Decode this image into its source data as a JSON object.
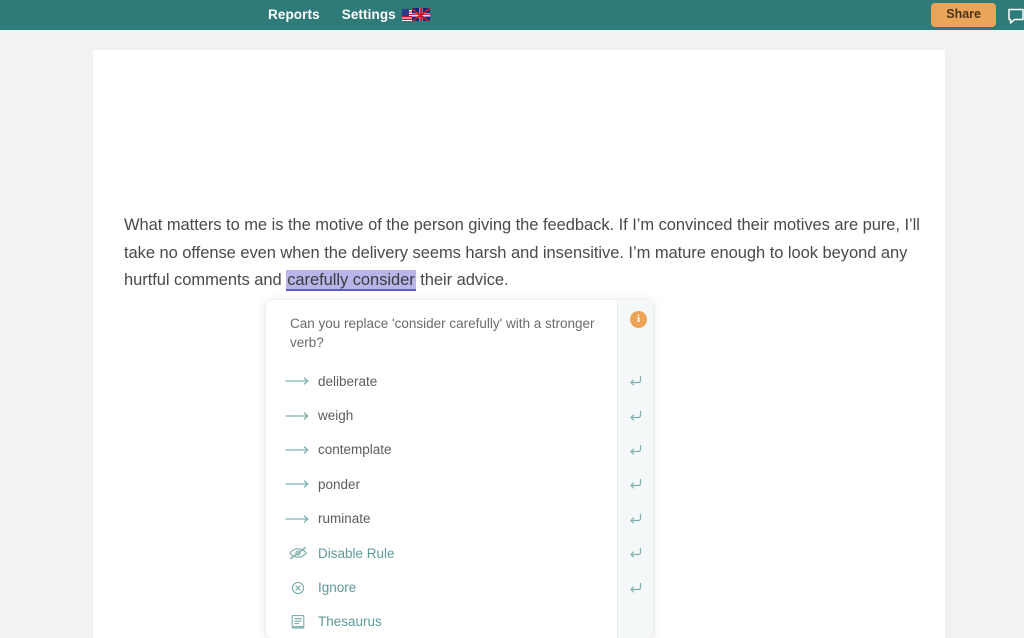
{
  "header": {
    "nav": [
      {
        "label": "Reports",
        "name": "nav-reports"
      },
      {
        "label": "Settings",
        "name": "nav-settings"
      }
    ],
    "language_flags": "us-uk-flags-icon",
    "share_label": "Share",
    "comment_icon": "speech-bubble-icon"
  },
  "document": {
    "paragraph": {
      "before": "What matters to me is the motive of the person giving the feedback. If I’m convinced their motives are pure, I’ll take no offense even when the delivery seems harsh and insensitive. I’m mature enough to look beyond any hurtful comments and ",
      "highlight": "carefully consider",
      "after": " their advice."
    }
  },
  "suggestion_card": {
    "question": "Can you replace 'consider carefully' with a stronger verb?",
    "info_badge": "i",
    "info_icon": "info-circle-icon",
    "options": [
      {
        "label": "deliberate",
        "icon": "long-arrow-right-icon",
        "kind": "replacement",
        "return_key": true
      },
      {
        "label": "weigh",
        "icon": "long-arrow-right-icon",
        "kind": "replacement",
        "return_key": true
      },
      {
        "label": "contemplate",
        "icon": "long-arrow-right-icon",
        "kind": "replacement",
        "return_key": true
      },
      {
        "label": "ponder",
        "icon": "long-arrow-right-icon",
        "kind": "replacement",
        "return_key": true
      },
      {
        "label": "ruminate",
        "icon": "long-arrow-right-icon",
        "kind": "replacement",
        "return_key": true
      },
      {
        "label": "Disable Rule",
        "icon": "eye-slash-icon",
        "kind": "action",
        "return_key": true
      },
      {
        "label": "Ignore",
        "icon": "circle-x-icon",
        "kind": "action",
        "return_key": true
      },
      {
        "label": "Thesaurus",
        "icon": "book-list-icon",
        "kind": "action",
        "return_key": false
      }
    ]
  },
  "colors": {
    "header_teal": "#2f7b79",
    "share_orange": "#eba558",
    "highlight_lavender": "#b9b5ea",
    "highlight_underline": "#6257d2",
    "accent_teal": "#5f9a99",
    "info_orange": "#eda355",
    "page_background": "#f2f2f2",
    "sheet_white": "#ffffff"
  }
}
